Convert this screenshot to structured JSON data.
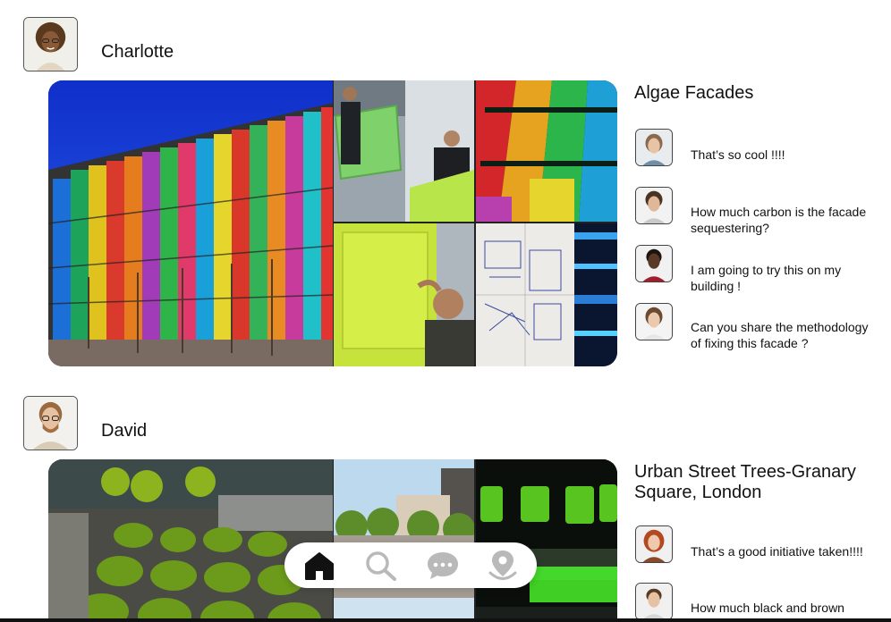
{
  "posts": [
    {
      "user": {
        "name": "Charlotte",
        "avatar_icon": "user-avatar-charlotte"
      },
      "title": "Algae Facades",
      "comments": [
        {
          "text": "That’s so cool !!!!",
          "avatar_icon": "commenter-avatar"
        },
        {
          "text": "How much carbon is the facade sequestering?",
          "avatar_icon": "commenter-avatar"
        },
        {
          "text": "I am going to try this on my building !",
          "avatar_icon": "commenter-avatar"
        },
        {
          "text": "Can you share the methodology of fixing this facade ?",
          "avatar_icon": "commenter-avatar"
        }
      ]
    },
    {
      "user": {
        "name": "David",
        "avatar_icon": "user-avatar-david"
      },
      "title": "Urban Street Trees-Granary Square, London",
      "comments": [
        {
          "text": "That’s a good initiative taken!!!!",
          "avatar_icon": "commenter-avatar"
        },
        {
          "text": "How much black and brown",
          "avatar_icon": "commenter-avatar"
        }
      ]
    }
  ],
  "nav": {
    "items": [
      {
        "name": "home",
        "icon": "home-icon",
        "active": true
      },
      {
        "name": "search",
        "icon": "search-icon",
        "active": false
      },
      {
        "name": "messages",
        "icon": "chat-bubble-icon",
        "active": false
      },
      {
        "name": "map",
        "icon": "map-pin-icon",
        "active": false
      }
    ]
  },
  "colors": {
    "active_icon": "#111111",
    "inactive_icon": "#b9b9b9",
    "nav_background": "#ffffff"
  }
}
